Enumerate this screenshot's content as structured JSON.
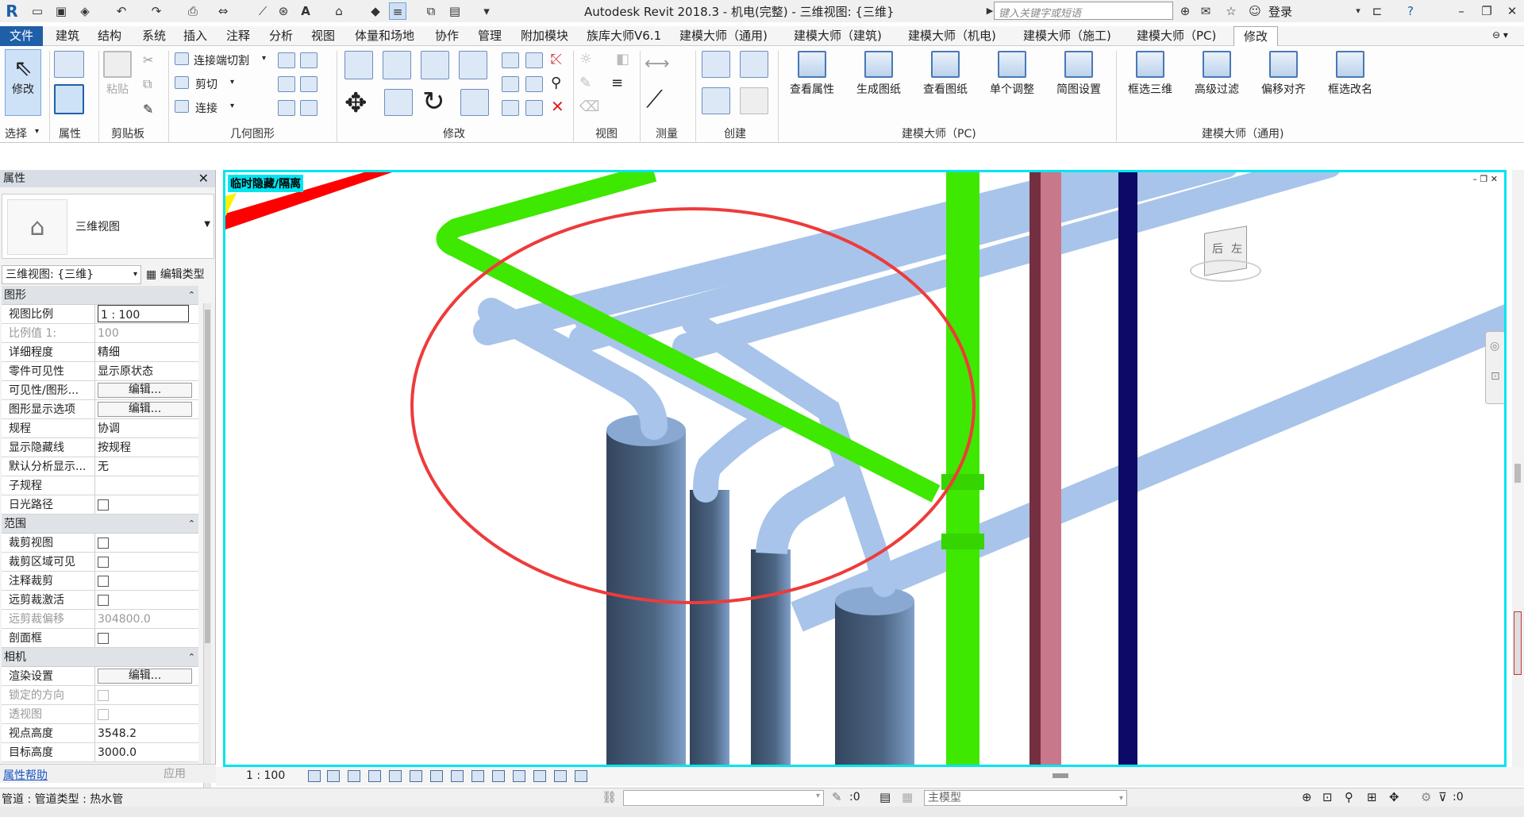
{
  "window": {
    "title": "Autodesk Revit 2018.3 -    机电(完整) - 三维视图: {三维}",
    "search_placeholder": "键入关键字或短语",
    "signin": "登录"
  },
  "tabs": [
    "文件",
    "建筑",
    "结构",
    "系统",
    "插入",
    "注释",
    "分析",
    "视图",
    "体量和场地",
    "协作",
    "管理",
    "附加模块",
    "族库大师V6.1",
    "建模大师（通用)",
    "建模大师（建筑)",
    "建模大师（机电)",
    "建模大师（施工)",
    "建模大师（PC)",
    "修改"
  ],
  "ribbon": {
    "panels": {
      "select": "选择",
      "properties": "属性",
      "clipboard": "剪贴板",
      "geometry": "几何图形",
      "modify": "修改",
      "view": "视图",
      "measure": "测量",
      "create": "创建",
      "pc": "建模大师（PC)",
      "general": "建模大师（通用)"
    },
    "modify_btn": "修改",
    "paste_btn": "粘贴",
    "connect_end_cut": "连接端切割",
    "cut": "剪切",
    "join": "连接",
    "pc_buttons": [
      "查看属性",
      "生成图纸",
      "查看图纸",
      "单个调整",
      "简图设置"
    ],
    "general_buttons": [
      "框选三维",
      "高级过滤",
      "偏移对齐",
      "框选改名"
    ]
  },
  "properties": {
    "title": "属性",
    "type_name": "三维视图",
    "instance_selector": "三维视图: {三维}",
    "edit_type": "编辑类型",
    "sections": {
      "graphics": {
        "label": "图形",
        "rows": [
          {
            "name": "视图比例",
            "value": "1 : 100"
          },
          {
            "name": "比例值 1:",
            "value": "100"
          },
          {
            "name": "详细程度",
            "value": "精细"
          },
          {
            "name": "零件可见性",
            "value": "显示原状态"
          },
          {
            "name": "可见性/图形...",
            "value": "编辑..."
          },
          {
            "name": "图形显示选项",
            "value": "编辑..."
          },
          {
            "name": "规程",
            "value": "协调"
          },
          {
            "name": "显示隐藏线",
            "value": "按规程"
          },
          {
            "name": "默认分析显示...",
            "value": "无"
          },
          {
            "name": "子规程",
            "value": ""
          },
          {
            "name": "日光路径",
            "value": ""
          }
        ]
      },
      "extents": {
        "label": "范围",
        "rows": [
          {
            "name": "裁剪视图",
            "value": ""
          },
          {
            "name": "裁剪区域可见",
            "value": ""
          },
          {
            "name": "注释裁剪",
            "value": ""
          },
          {
            "name": "远剪裁激活",
            "value": ""
          },
          {
            "name": "远剪裁偏移",
            "value": "304800.0"
          },
          {
            "name": "剖面框",
            "value": ""
          }
        ]
      },
      "camera": {
        "label": "相机",
        "rows": [
          {
            "name": "渲染设置",
            "value": "编辑..."
          },
          {
            "name": "锁定的方向",
            "value": ""
          },
          {
            "name": "透视图",
            "value": ""
          },
          {
            "name": "视点高度",
            "value": "3548.2"
          },
          {
            "name": "目标高度",
            "value": "3000.0"
          }
        ]
      }
    },
    "help": "属性帮助",
    "apply": "应用"
  },
  "viewport": {
    "temp_label": "临时隐藏/隔离",
    "viewcube_faces": {
      "back": "后",
      "left": "左"
    },
    "colors": {
      "pipe": "#a8c4ea",
      "pipe_shade": "#7f9fc8",
      "green_pipe": "#3ee800",
      "highlight_circle": "#ee3b3b",
      "border": "#00e5ee"
    }
  },
  "view_bar": {
    "scale": "1 : 100"
  },
  "status_bar": {
    "selection": "管道 : 管道类型 : 热水管",
    "model": "主模型",
    "count_left": ":0",
    "count_right": ":0"
  }
}
